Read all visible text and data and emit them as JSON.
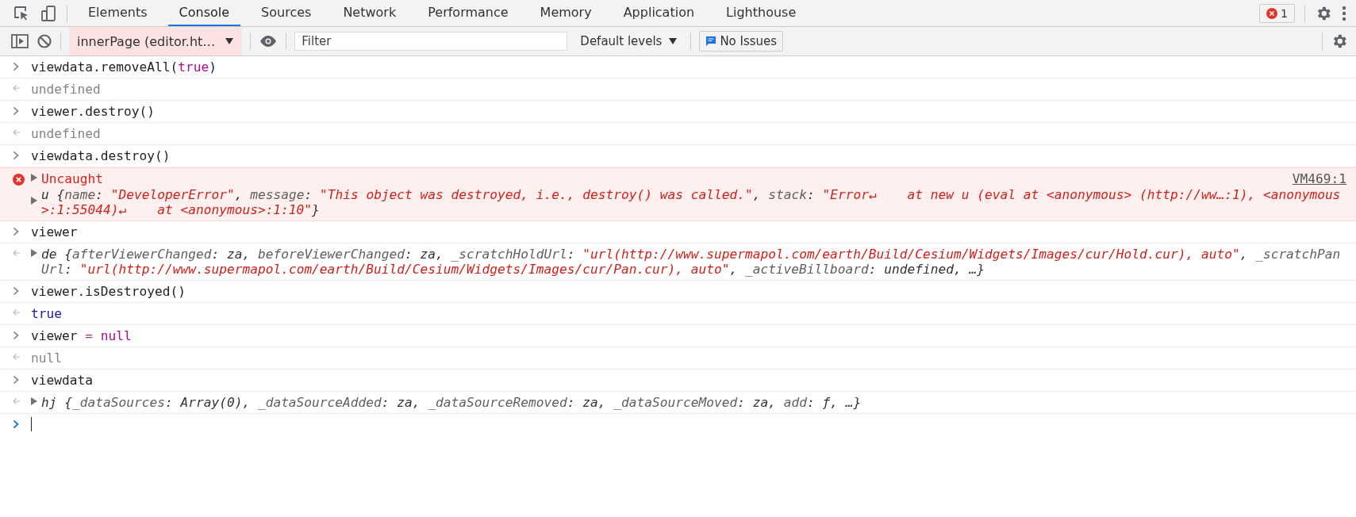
{
  "tabs": [
    {
      "label": "Elements",
      "selected": false
    },
    {
      "label": "Console",
      "selected": true
    },
    {
      "label": "Sources",
      "selected": false
    },
    {
      "label": "Network",
      "selected": false
    },
    {
      "label": "Performance",
      "selected": false
    },
    {
      "label": "Memory",
      "selected": false
    },
    {
      "label": "Application",
      "selected": false
    },
    {
      "label": "Lighthouse",
      "selected": false
    }
  ],
  "error_badge": "1",
  "console_toolbar": {
    "context": "innerPage (editor.ht…",
    "filter": {
      "placeholder": "Filter"
    },
    "levels": "Default levels",
    "issues": "No Issues"
  },
  "entries": [
    {
      "kind": "input",
      "tokens": [
        {
          "text": "viewdata.removeAll(",
          "kind": "plain"
        },
        {
          "text": "true",
          "kind": "keyword"
        },
        {
          "text": ")",
          "kind": "plain"
        }
      ]
    },
    {
      "kind": "result",
      "expandable": false,
      "tokens": [
        {
          "text": "undefined",
          "kind": "undefined"
        }
      ]
    },
    {
      "kind": "input",
      "tokens": [
        {
          "text": "viewer.destroy()",
          "kind": "plain"
        }
      ]
    },
    {
      "kind": "result",
      "expandable": false,
      "tokens": [
        {
          "text": "undefined",
          "kind": "undefined"
        }
      ]
    },
    {
      "kind": "input",
      "tokens": [
        {
          "text": "viewdata.destroy()",
          "kind": "plain"
        }
      ]
    },
    {
      "kind": "error",
      "title": "Uncaught",
      "source": "VM469:1",
      "expandable": true,
      "tokens": [
        {
          "text": "u {",
          "kind": "object"
        },
        {
          "text": "name",
          "kind": "key"
        },
        {
          "text": ": ",
          "kind": "object"
        },
        {
          "text": "\"DeveloperError\"",
          "kind": "string"
        },
        {
          "text": ", ",
          "kind": "object"
        },
        {
          "text": "message",
          "kind": "key"
        },
        {
          "text": ": ",
          "kind": "object"
        },
        {
          "text": "\"This object was destroyed, i.e., destroy() was called.\"",
          "kind": "string"
        },
        {
          "text": ", ",
          "kind": "object"
        },
        {
          "text": "stack",
          "kind": "key"
        },
        {
          "text": ": ",
          "kind": "object"
        },
        {
          "text": "\"Error↵    at new u (eval at <anonymous> (http://ww…:1), <anonymous>:1:55044)↵    at <anonymous>:1:10\"",
          "kind": "string"
        },
        {
          "text": "}",
          "kind": "object"
        }
      ]
    },
    {
      "kind": "input",
      "tokens": [
        {
          "text": "viewer",
          "kind": "plain"
        }
      ]
    },
    {
      "kind": "result",
      "expandable": true,
      "tokens": [
        {
          "text": "de {",
          "kind": "object"
        },
        {
          "text": "afterViewerChanged",
          "kind": "key"
        },
        {
          "text": ": za, ",
          "kind": "object"
        },
        {
          "text": "beforeViewerChanged",
          "kind": "key"
        },
        {
          "text": ": za, ",
          "kind": "object"
        },
        {
          "text": "_scratchHoldUrl",
          "kind": "key"
        },
        {
          "text": ": ",
          "kind": "object"
        },
        {
          "text": "\"url(http://www.supermapol.com/earth/Build/Cesium/Widgets/Images/cur/Hold.cur), auto\"",
          "kind": "string"
        },
        {
          "text": ", ",
          "kind": "object"
        },
        {
          "text": "_scratchPanUrl",
          "kind": "key"
        },
        {
          "text": ": ",
          "kind": "object"
        },
        {
          "text": "\"url(http://www.supermapol.com/earth/Build/Cesium/Widgets/Images/cur/Pan.cur), auto\"",
          "kind": "string"
        },
        {
          "text": ", ",
          "kind": "object"
        },
        {
          "text": "_activeBillboard",
          "kind": "key"
        },
        {
          "text": ": undefined, …}",
          "kind": "object"
        }
      ]
    },
    {
      "kind": "input",
      "tokens": [
        {
          "text": "viewer.isDestroyed()",
          "kind": "plain"
        }
      ]
    },
    {
      "kind": "result",
      "expandable": false,
      "tokens": [
        {
          "text": "true",
          "kind": "boolean"
        }
      ]
    },
    {
      "kind": "input",
      "tokens": [
        {
          "text": "viewer ",
          "kind": "plain"
        },
        {
          "text": "= ",
          "kind": "operator"
        },
        {
          "text": "null",
          "kind": "keyword"
        }
      ]
    },
    {
      "kind": "result",
      "expandable": false,
      "tokens": [
        {
          "text": "null",
          "kind": "undefined"
        }
      ]
    },
    {
      "kind": "input",
      "tokens": [
        {
          "text": "viewdata",
          "kind": "plain"
        }
      ]
    },
    {
      "kind": "result",
      "expandable": true,
      "tokens": [
        {
          "text": "hj {",
          "kind": "object"
        },
        {
          "text": "_dataSources",
          "kind": "key"
        },
        {
          "text": ": Array(0), ",
          "kind": "object"
        },
        {
          "text": "_dataSourceAdded",
          "kind": "key"
        },
        {
          "text": ": za, ",
          "kind": "object"
        },
        {
          "text": "_dataSourceRemoved",
          "kind": "key"
        },
        {
          "text": ": za, ",
          "kind": "object"
        },
        {
          "text": "_dataSourceMoved",
          "kind": "key"
        },
        {
          "text": ": za, ",
          "kind": "object"
        },
        {
          "text": "add",
          "kind": "key"
        },
        {
          "text": ": ƒ, …}",
          "kind": "object"
        }
      ]
    }
  ]
}
